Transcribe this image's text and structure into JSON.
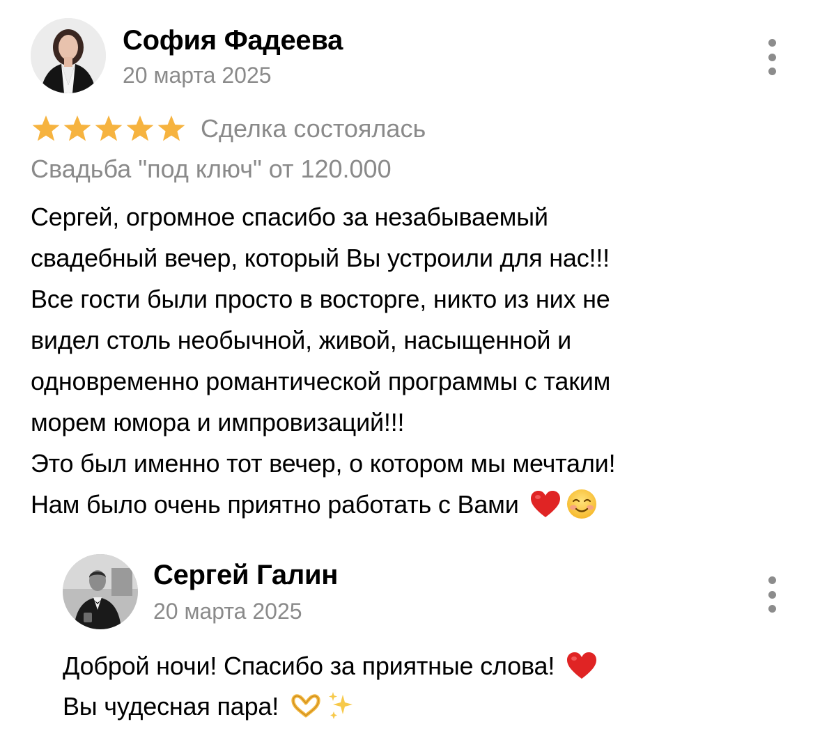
{
  "review": {
    "author": "София Фадеева",
    "date": "20 марта 2025",
    "rating": 5,
    "rating_max": 5,
    "deal_status": "Сделка состоялась",
    "service": "Свадьба \"под ключ\" от 120.000",
    "text_lines": [
      "Сергей, огромное спасибо за незабываемый",
      "свадебный вечер, который Вы устроили для нас!!!",
      "Все гости были просто в восторге, никто из них не",
      "видел столь необычной, живой, насыщенной и",
      "одновременно романтической программы с таким",
      "морем юмора и импровизаций!!!",
      "Это был именно тот вечер, о котором мы мечтали!",
      "Нам было очень приятно работать с Вами"
    ],
    "last_line_emojis": [
      "red-heart",
      "smiling-face"
    ]
  },
  "reply": {
    "author": "Сергей Галин",
    "date": "20 марта 2025",
    "text_lines": [
      "Доброй ночи! Спасибо за приятные слова!",
      "Вы чудесная пара!"
    ],
    "line_emojis": [
      [
        "red-heart"
      ],
      [
        "heart-hands",
        "sparkles"
      ]
    ]
  },
  "icons": {
    "star": "star-icon",
    "more": "more-vertical-icon"
  },
  "colors": {
    "star": "#F6B33F",
    "muted_text": "#8A8A8A",
    "kebab_dots": "#8C8C8C",
    "heart": "#E02424"
  }
}
